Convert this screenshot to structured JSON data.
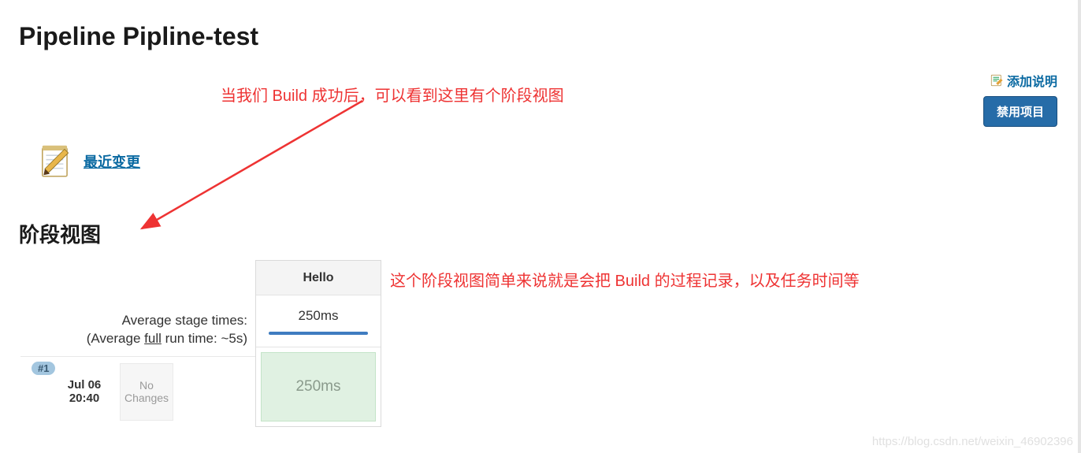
{
  "page": {
    "title": "Pipeline Pipline-test",
    "stage_view_heading": "阶段视图"
  },
  "actions": {
    "add_description": "添加说明",
    "disable_project": "禁用项目"
  },
  "changes": {
    "recent_changes_link": "最近变更"
  },
  "annotations": {
    "top": "当我们 Build 成功后，可以看到这里有个阶段视图",
    "mid": "这个阶段视图简单来说就是会把 Build 的过程记录，以及任务时间等"
  },
  "stage_view": {
    "avg_label": "Average stage times:",
    "avg_full_prefix": "(Average ",
    "avg_full_word": "full",
    "avg_full_suffix": " run time: ~5s)",
    "stages": [
      {
        "name": "Hello",
        "avg_time": "250ms",
        "cells": [
          "250ms"
        ]
      }
    ],
    "runs": [
      {
        "id": "#1",
        "date": "Jul 06",
        "time": "20:40",
        "changes": "No\nChanges"
      }
    ]
  },
  "watermark": "https://blog.csdn.net/weixin_46902396"
}
